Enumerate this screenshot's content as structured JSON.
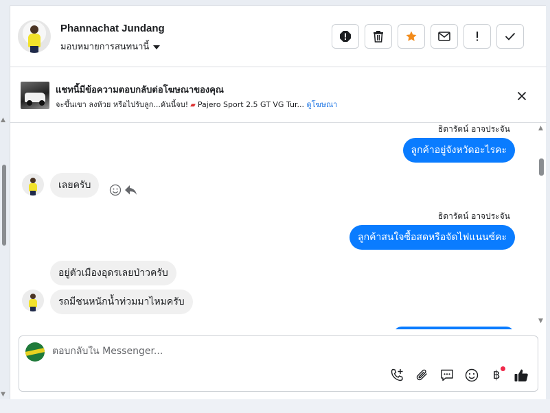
{
  "header": {
    "contact_name": "Phannachat Jundang",
    "assign_label": "มอบหมายการสนทนานี้",
    "actions": [
      {
        "name": "report-icon"
      },
      {
        "name": "trash-icon"
      },
      {
        "name": "star-icon",
        "color": "#f28b1b"
      },
      {
        "name": "envelope-icon"
      },
      {
        "name": "exclamation-icon"
      },
      {
        "name": "checkmark-icon"
      }
    ]
  },
  "ad_banner": {
    "title": "แชทนี้มีข้อความตอบกลับต่อโฆษณาของคุณ",
    "subtitle": "จะขึ้นเขา ลงห้วย หรือไปรับลูก...คันนี้จบ!",
    "product": "Pajero Sport 2.5 GT VG Tur...",
    "link": "ดูโฆษณา"
  },
  "conversation": {
    "messages": [
      {
        "sender_name": "ธิดารัตน์ อาจประจัน",
        "text": "ลูกค้าอยู่จังหวัดอะไรคะ",
        "direction": "out"
      },
      {
        "text": "เลยครับ",
        "direction": "in"
      },
      {
        "sender_name": "ธิดารัตน์ อาจประจัน",
        "text": "ลูกค้าสนใจซื้อสดหรือจัดไฟแนนซ์คะ",
        "direction": "out"
      },
      {
        "text": "อยู่ตัวเมืองอุดรเลยป่าวครับ",
        "direction": "in"
      },
      {
        "text": "รถมีชนหนักน้ำท่วมมาไหมครับ",
        "direction": "in"
      }
    ]
  },
  "composer": {
    "placeholder": "ตอบกลับใน Messenger...",
    "value": "",
    "tools": [
      "phone-add-icon",
      "attachment-icon",
      "saved-reply-icon",
      "emoji-icon",
      "baht-icon",
      "thumbs-up-icon"
    ],
    "baht_symbol": "฿"
  },
  "colors": {
    "accent": "#0a7cff",
    "incoming_bubble": "#f0f0f0",
    "notification_dot": "#f02849",
    "link": "#1b74e4"
  }
}
